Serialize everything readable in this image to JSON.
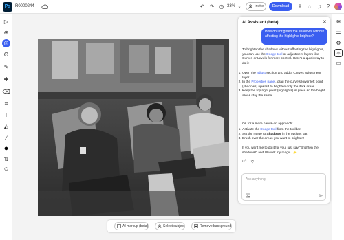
{
  "app": {
    "logo": "Ps",
    "doc_title": "R0000244"
  },
  "topbar": {
    "zoom": "33%",
    "invite_label": "Invite",
    "download_label": "Download",
    "icons": [
      "undo-icon",
      "redo-icon",
      "history-icon",
      "zoom-chevron-icon",
      "upload-icon",
      "bulb-icon",
      "bell-icon",
      "help-icon"
    ]
  },
  "bottombar": {
    "buttons": [
      "AI markup (beta)",
      "Select subject",
      "Remove background"
    ]
  },
  "panel": {
    "title": "AI Assistant (beta)",
    "user_message": "How do I brighten the shadows without affecting the highlights brighter?",
    "intro": "To brighten the shadows without affecting the highlights, you can use the",
    "intro_link": "Dodge tool",
    "intro_rest": "or adjustment layers like Curves or Levels for more control. Here's a quick way to do it:",
    "steps1": [
      {
        "pre": "Open the ",
        "link": "adjust",
        "post": " section and add a Curves adjustment layer."
      },
      {
        "pre": "In the ",
        "link": "Properties panel",
        "post": ", drag the curve's lower left point (shadows) upward to brighten only the dark areas."
      },
      {
        "pre": "Keep the top right point (highlights) in place so the bright areas stay the same.",
        "link": "",
        "post": ""
      }
    ],
    "alt_intro": "Or, for a more hands-on approach:",
    "steps2": [
      {
        "pre": "Activate the ",
        "link": "Dodge tool",
        "post": " from the toolbar."
      },
      {
        "pre": "Set the range to ",
        "link": "Shadows",
        "post": " in the options bar."
      },
      {
        "pre": "Brush over the areas you want to brighten!",
        "link": "",
        "post": ""
      }
    ],
    "outro": "If you want me to do it for you, just say \"Brighten the shadows!\" and I'll work my magic. ✨",
    "ask_placeholder": "Ask anything"
  },
  "colors": {
    "accent": "#3a5ef0",
    "brand_dark": "#001e36",
    "brand_light": "#31a8ff"
  }
}
